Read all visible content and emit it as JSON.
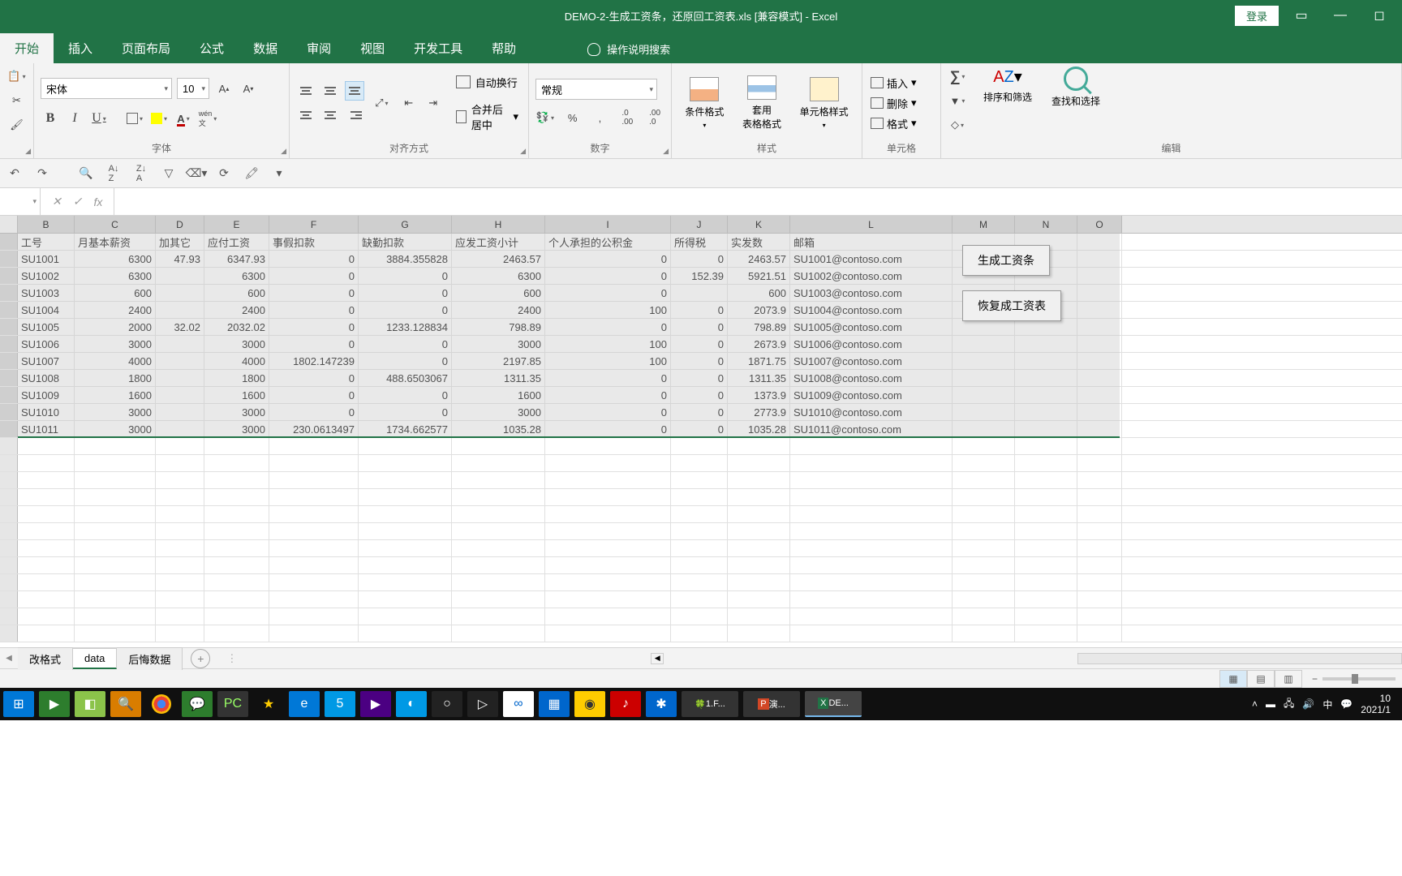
{
  "title": "DEMO-2-生成工资条，还原回工资表.xls  [兼容模式]  -  Excel",
  "login": "登录",
  "tabs": [
    "开始",
    "插入",
    "页面布局",
    "公式",
    "数据",
    "审阅",
    "视图",
    "开发工具",
    "帮助"
  ],
  "active_tab": "开始",
  "tell_me": "操作说明搜索",
  "font": {
    "name": "宋体",
    "size": "10"
  },
  "groups": {
    "font": "字体",
    "align": "对齐方式",
    "number": "数字",
    "style": "样式",
    "cell": "单元格",
    "edit": "编辑"
  },
  "wrap_text": "自动换行",
  "merge_center": "合并后居中",
  "number_format": "常规",
  "style_cond": "条件格式",
  "style_table": "套用\n表格格式",
  "style_cell": "单元格样式",
  "cell_insert": "插入",
  "cell_delete": "删除",
  "cell_format": "格式",
  "edit_sort": "排序和筛选",
  "edit_find": "查找和选择",
  "columns": [
    "B",
    "C",
    "D",
    "E",
    "F",
    "G",
    "H",
    "I",
    "J",
    "K",
    "L",
    "M",
    "N",
    "O"
  ],
  "headers": {
    "B": "工号",
    "C": "月基本薪资",
    "D": "加其它",
    "E": "应付工资",
    "F": "事假扣款",
    "G": "缺勤扣款",
    "H": "应发工资小计",
    "I": "个人承担的公积金",
    "J": "所得税",
    "K": "实发数",
    "L": "邮箱"
  },
  "rows": [
    {
      "B": "SU1001",
      "C": "6300",
      "D": "47.93",
      "E": "6347.93",
      "F": "0",
      "G": "3884.355828",
      "H": "2463.57",
      "I": "0",
      "J": "0",
      "K": "2463.57",
      "L": "SU1001@contoso.com"
    },
    {
      "B": "SU1002",
      "C": "6300",
      "D": "",
      "E": "6300",
      "F": "0",
      "G": "0",
      "H": "6300",
      "I": "0",
      "J": "152.39",
      "K": "5921.51",
      "L": "SU1002@contoso.com"
    },
    {
      "B": "SU1003",
      "C": "600",
      "D": "",
      "E": "600",
      "F": "0",
      "G": "0",
      "H": "600",
      "I": "0",
      "J": "",
      "K": "600",
      "L": "SU1003@contoso.com"
    },
    {
      "B": "SU1004",
      "C": "2400",
      "D": "",
      "E": "2400",
      "F": "0",
      "G": "0",
      "H": "2400",
      "I": "100",
      "J": "0",
      "K": "2073.9",
      "L": "SU1004@contoso.com"
    },
    {
      "B": "SU1005",
      "C": "2000",
      "D": "32.02",
      "E": "2032.02",
      "F": "0",
      "G": "1233.128834",
      "H": "798.89",
      "I": "0",
      "J": "0",
      "K": "798.89",
      "L": "SU1005@contoso.com"
    },
    {
      "B": "SU1006",
      "C": "3000",
      "D": "",
      "E": "3000",
      "F": "0",
      "G": "0",
      "H": "3000",
      "I": "100",
      "J": "0",
      "K": "2673.9",
      "L": "SU1006@contoso.com"
    },
    {
      "B": "SU1007",
      "C": "4000",
      "D": "",
      "E": "4000",
      "F": "1802.147239",
      "G": "0",
      "H": "2197.85",
      "I": "100",
      "J": "0",
      "K": "1871.75",
      "L": "SU1007@contoso.com"
    },
    {
      "B": "SU1008",
      "C": "1800",
      "D": "",
      "E": "1800",
      "F": "0",
      "G": "488.6503067",
      "H": "1311.35",
      "I": "0",
      "J": "0",
      "K": "1311.35",
      "L": "SU1008@contoso.com"
    },
    {
      "B": "SU1009",
      "C": "1600",
      "D": "",
      "E": "1600",
      "F": "0",
      "G": "0",
      "H": "1600",
      "I": "0",
      "J": "0",
      "K": "1373.9",
      "L": "SU1009@contoso.com"
    },
    {
      "B": "SU1010",
      "C": "3000",
      "D": "",
      "E": "3000",
      "F": "0",
      "G": "0",
      "H": "3000",
      "I": "0",
      "J": "0",
      "K": "2773.9",
      "L": "SU1010@contoso.com"
    },
    {
      "B": "SU1011",
      "C": "3000",
      "D": "",
      "E": "3000",
      "F": "230.0613497",
      "G": "1734.662577",
      "H": "1035.28",
      "I": "0",
      "J": "0",
      "K": "1035.28",
      "L": "SU1011@contoso.com"
    }
  ],
  "embed_buttons": {
    "gen": "生成工资条",
    "restore": "恢复成工资表"
  },
  "sheets": [
    "改格式",
    "data",
    "后悔数据"
  ],
  "active_sheet": "data",
  "taskbar": {
    "app1": "1.F...",
    "app2": "演...",
    "app3": "DE...",
    "ime": "中",
    "time": "10",
    "date": "2021/1"
  }
}
